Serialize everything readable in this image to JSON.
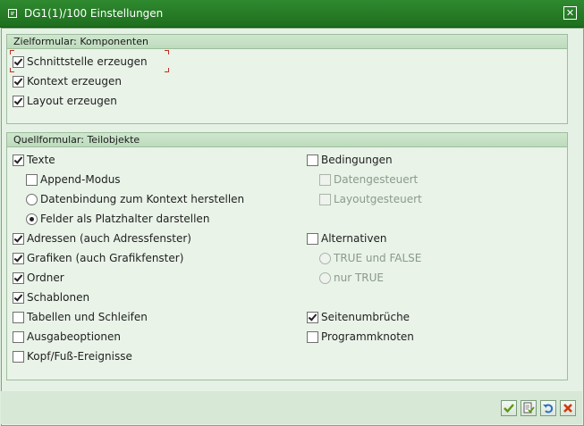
{
  "window": {
    "title": "DG1(1)/100 Einstellungen",
    "close_glyph": "✕"
  },
  "group_target": {
    "title": "Zielformular: Komponenten",
    "items": [
      {
        "label": "Schnittstelle erzeugen",
        "checked": true
      },
      {
        "label": "Kontext erzeugen",
        "checked": true
      },
      {
        "label": "Layout erzeugen",
        "checked": true
      }
    ]
  },
  "group_source": {
    "title": "Quellformular: Teilobjekte",
    "left": {
      "texte": {
        "label": "Texte",
        "checked": true
      },
      "append_modus": {
        "label": "Append-Modus",
        "checked": false
      },
      "radio_datenbindung": {
        "label": "Datenbindung zum Kontext herstellen",
        "selected": false
      },
      "radio_platzhalter": {
        "label": "Felder als Platzhalter darstellen",
        "selected": true
      },
      "adressen": {
        "label": "Adressen (auch Adressfenster)",
        "checked": true
      },
      "grafiken": {
        "label": "Grafiken (auch Grafikfenster)",
        "checked": true
      },
      "ordner": {
        "label": "Ordner",
        "checked": true
      },
      "schablonen": {
        "label": "Schablonen",
        "checked": true
      },
      "tabellen": {
        "label": "Tabellen und Schleifen",
        "checked": false
      },
      "ausgabeoptionen": {
        "label": "Ausgabeoptionen",
        "checked": false
      },
      "kopf_fuss": {
        "label": "Kopf/Fuß-Ereignisse",
        "checked": false
      }
    },
    "right": {
      "bedingungen": {
        "label": "Bedingungen",
        "checked": false
      },
      "datengesteuert": {
        "label": "Datengesteuert",
        "checked": false,
        "disabled": true
      },
      "layoutgesteuert": {
        "label": "Layoutgesteuert",
        "checked": false,
        "disabled": true
      },
      "alternativen": {
        "label": "Alternativen",
        "checked": false
      },
      "radio_true_false": {
        "label": "TRUE und FALSE",
        "selected": false,
        "disabled": true
      },
      "radio_nur_true": {
        "label": "nur TRUE",
        "selected": false,
        "disabled": true
      },
      "seitenumbrueche": {
        "label": "Seitenumbrüche",
        "checked": true
      },
      "programmknoten": {
        "label": "Programmknoten",
        "checked": false
      }
    }
  },
  "footer": {
    "buttons": [
      "confirm-icon",
      "check-icon",
      "undo-icon",
      "cancel-icon"
    ]
  },
  "colors": {
    "titlebar": "#2f8a2f",
    "dialog_bg": "#e6f1e5",
    "group_header": "#c5e0c4",
    "focus_frame": "#c03020"
  }
}
